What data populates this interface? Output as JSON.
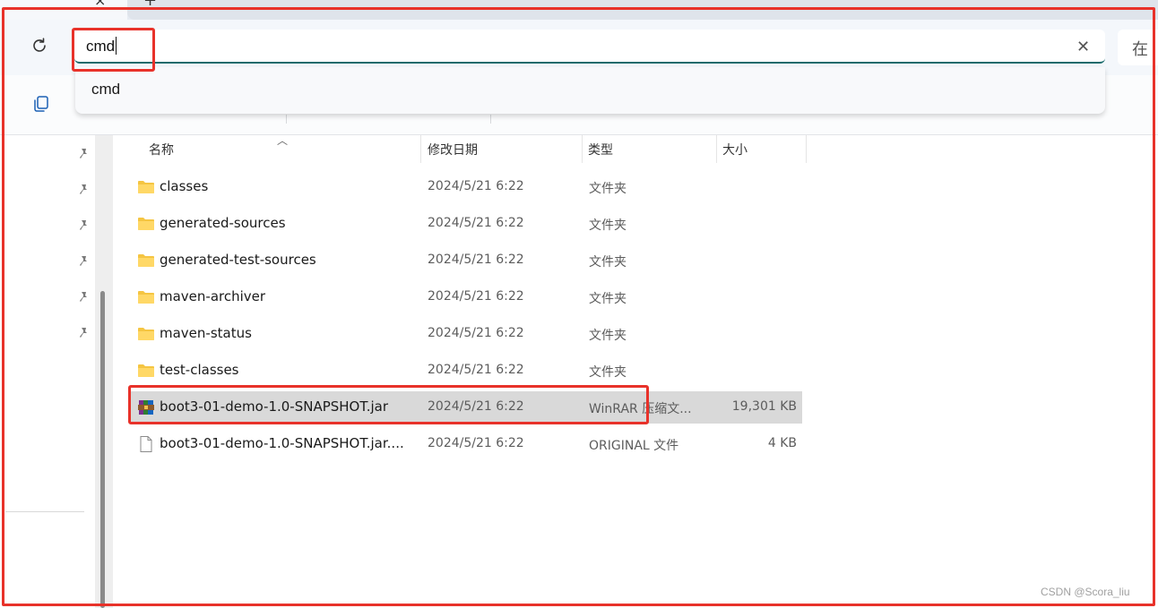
{
  "tab": {
    "close_icon": "close-icon",
    "new_icon": "plus-icon",
    "close_glyph": "×",
    "new_glyph": "+"
  },
  "address_bar": {
    "value": "cmd",
    "clear_glyph": "✕",
    "right_button_label": "在"
  },
  "suggestions": [
    "cmd"
  ],
  "columns": {
    "name": "名称",
    "modified": "修改日期",
    "type": "类型",
    "size": "大小"
  },
  "files": [
    {
      "icon": "folder-icon",
      "name": "classes",
      "modified": "2024/5/21 6:22",
      "type": "文件夹",
      "size": "",
      "selected": false
    },
    {
      "icon": "folder-icon",
      "name": "generated-sources",
      "modified": "2024/5/21 6:22",
      "type": "文件夹",
      "size": "",
      "selected": false
    },
    {
      "icon": "folder-icon",
      "name": "generated-test-sources",
      "modified": "2024/5/21 6:22",
      "type": "文件夹",
      "size": "",
      "selected": false
    },
    {
      "icon": "folder-icon",
      "name": "maven-archiver",
      "modified": "2024/5/21 6:22",
      "type": "文件夹",
      "size": "",
      "selected": false
    },
    {
      "icon": "folder-icon",
      "name": "maven-status",
      "modified": "2024/5/21 6:22",
      "type": "文件夹",
      "size": "",
      "selected": false
    },
    {
      "icon": "folder-icon",
      "name": "test-classes",
      "modified": "2024/5/21 6:22",
      "type": "文件夹",
      "size": "",
      "selected": false
    },
    {
      "icon": "winrar-archive-icon",
      "name": "boot3-01-demo-1.0-SNAPSHOT.jar",
      "modified": "2024/5/21 6:22",
      "type": "WinRAR 压缩文...",
      "size": "19,301 KB",
      "selected": true
    },
    {
      "icon": "file-icon",
      "name": "boot3-01-demo-1.0-SNAPSHOT.jar....",
      "modified": "2024/5/21 6:22",
      "type": "ORIGINAL 文件",
      "size": "4 KB",
      "selected": false
    }
  ],
  "watermark": "CSDN @Scora_liu",
  "colors": {
    "annotation_red": "#e8322a",
    "address_underline": "#1b6b6b",
    "selection": "#d9d9d9"
  }
}
